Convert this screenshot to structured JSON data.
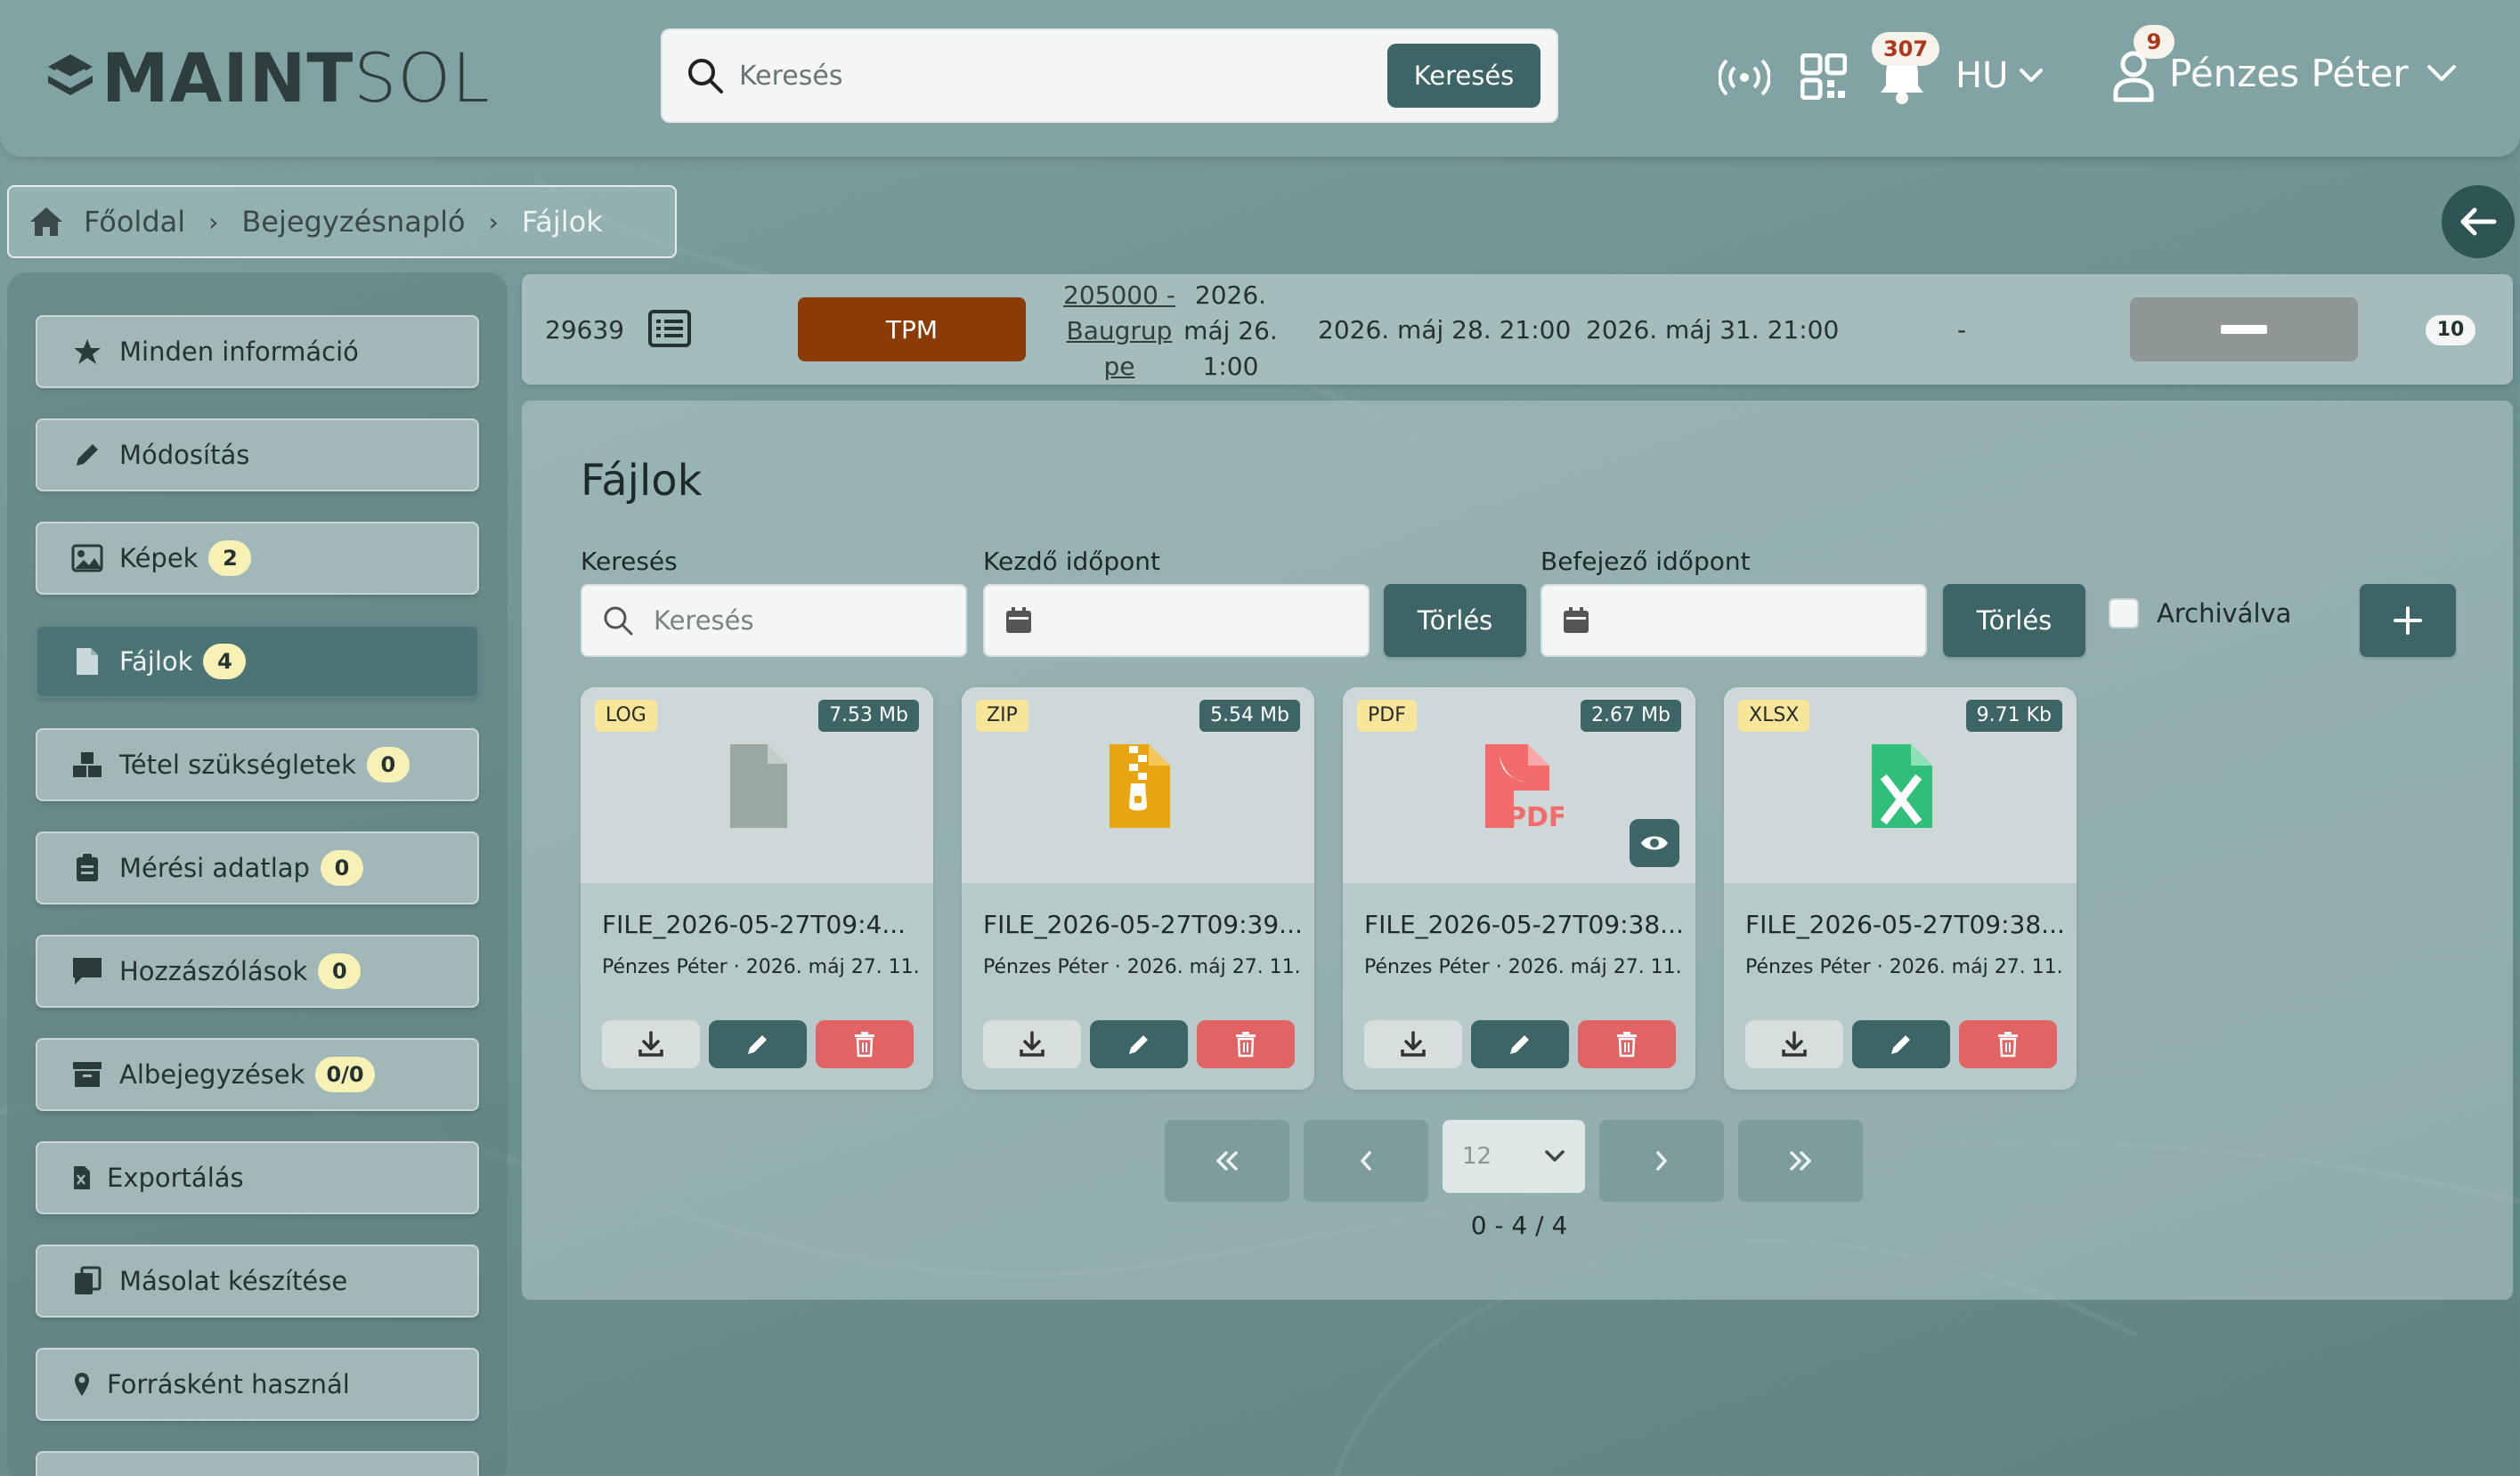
{
  "app": {
    "logo_bold": "MAINT",
    "logo_light": "SOL"
  },
  "header": {
    "search_placeholder": "Keresés",
    "search_button": "Keresés",
    "notification_count": "307",
    "language": "HU",
    "user_notification_count": "9",
    "user_name": "Pénzes Péter"
  },
  "breadcrumb": {
    "items": [
      "Főoldal",
      "Bejegyzésnapló",
      "Fájlok"
    ]
  },
  "sidebar": {
    "items": [
      {
        "label": "Minden információ",
        "icon": "star-icon",
        "count": null
      },
      {
        "label": "Módosítás",
        "icon": "pencil-icon",
        "count": null
      },
      {
        "label": "Képek",
        "icon": "image-icon",
        "count": "2"
      },
      {
        "label": "Fájlok",
        "icon": "file-icon",
        "count": "4"
      },
      {
        "label": "Tétel szükségletek",
        "icon": "boxes-icon",
        "count": "0"
      },
      {
        "label": "Mérési adatlap",
        "icon": "clipboard-icon",
        "count": "0"
      },
      {
        "label": "Hozzászólások",
        "icon": "comment-icon",
        "count": "0"
      },
      {
        "label": "Albejegyzések",
        "icon": "archive-icon",
        "count": "0/0"
      },
      {
        "label": "Exportálás",
        "icon": "excel-icon",
        "count": null
      },
      {
        "label": "Másolat készítése",
        "icon": "copy-icon",
        "count": null
      },
      {
        "label": "Forrásként használ",
        "icon": "location-pin-icon",
        "count": null
      }
    ]
  },
  "record": {
    "id": "29639",
    "type": "TPM",
    "asset_link": "205000 - Baugruppe",
    "created_line1": "2026.",
    "created_line2": "máj 26.",
    "created_line3": "1:00",
    "start": "2026. máj 28. 21:00",
    "end": "2026. máj 31. 21:00",
    "dash": "-",
    "counter": "10",
    "colors": {
      "type_badge": "#8a3b06"
    }
  },
  "files_panel": {
    "title": "Fájlok",
    "search_label": "Keresés",
    "search_placeholder": "Keresés",
    "start_label": "Kezdő időpont",
    "end_label": "Befejező időpont",
    "clear_label": "Törlés",
    "archived_label": "Archiválva",
    "files": [
      {
        "type": "LOG",
        "size": "7.53 Mb",
        "name": "FILE_2026-05-27T09:4...",
        "meta": "Pénzes Péter · 2026. máj 27. 11...",
        "icon": "generic-file-icon"
      },
      {
        "type": "ZIP",
        "size": "5.54 Mb",
        "name": "FILE_2026-05-27T09:39...",
        "meta": "Pénzes Péter · 2026. máj 27. 11...",
        "icon": "zip-file-icon"
      },
      {
        "type": "PDF",
        "size": "2.67 Mb",
        "name": "FILE_2026-05-27T09:38...",
        "meta": "Pénzes Péter · 2026. máj 27. 11...",
        "icon": "pdf-file-icon"
      },
      {
        "type": "XLSX",
        "size": "9.71 Kb",
        "name": "FILE_2026-05-27T09:38...",
        "meta": "Pénzes Péter · 2026. máj 27. 11...",
        "icon": "excel-file-icon"
      }
    ],
    "pagination": {
      "page_size": "12",
      "info": "0 - 4 / 4"
    }
  }
}
